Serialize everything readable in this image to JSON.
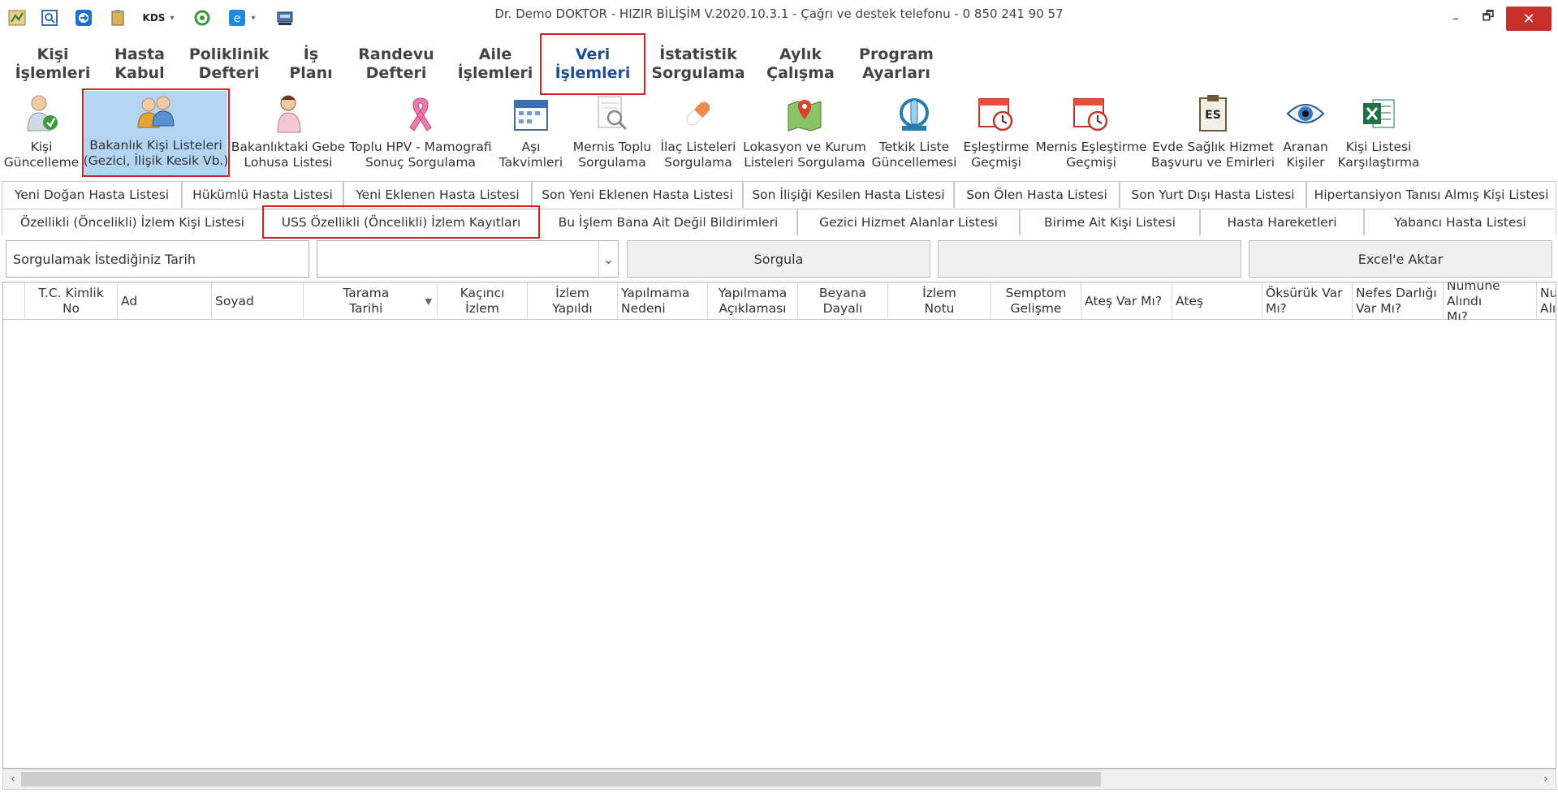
{
  "window": {
    "title": "Dr. Demo DOKTOR - HIZIR BİLİŞİM V.2020.10.3.1 - Çağrı ve destek telefonu - 0 850 241 90 57",
    "minimize": "–",
    "restore": "🗗",
    "close": "✕"
  },
  "quick_access": {
    "kds_label": "KDS",
    "dropdown_glyph": "▾"
  },
  "menu": [
    {
      "line1": "Kişi",
      "line2": "İşlemleri"
    },
    {
      "line1": "Hasta",
      "line2": "Kabul"
    },
    {
      "line1": "Poliklinik",
      "line2": "Defteri"
    },
    {
      "line1": "İş",
      "line2": "Planı"
    },
    {
      "line1": "Randevu",
      "line2": "Defteri"
    },
    {
      "line1": "Aile",
      "line2": "İşlemleri"
    },
    {
      "line1": "Veri",
      "line2": "İşlemleri"
    },
    {
      "line1": "İstatistik",
      "line2": "Sorgulama"
    },
    {
      "line1": "Aylık",
      "line2": "Çalışma"
    },
    {
      "line1": "Program",
      "line2": "Ayarları"
    }
  ],
  "ribbon": [
    {
      "line1": "Kişi",
      "line2": "Güncelleme",
      "icon": "person-update-icon"
    },
    {
      "line1": "Bakanlık Kişi Listeleri",
      "line2": "(Gezici, İlişik Kesik Vb.)",
      "icon": "people-group-icon"
    },
    {
      "line1": "Bakanlıktaki Gebe",
      "line2": "Lohusa Listesi",
      "icon": "pregnant-woman-icon"
    },
    {
      "line1": "Toplu HPV - Mamografi",
      "line2": "Sonuç Sorgulama",
      "icon": "pink-ribbon-icon"
    },
    {
      "line1": "Aşı",
      "line2": "Takvimleri",
      "icon": "calendar-icon"
    },
    {
      "line1": "Mernis Toplu",
      "line2": "Sorgulama",
      "icon": "document-search-icon"
    },
    {
      "line1": "İlaç Listeleri",
      "line2": "Sorgulama",
      "icon": "pill-icon"
    },
    {
      "line1": "Lokasyon ve Kurum",
      "line2": "Listeleri Sorgulama",
      "icon": "map-pin-icon"
    },
    {
      "line1": "Tetkik Liste",
      "line2": "Güncellemesi",
      "icon": "test-tube-refresh-icon"
    },
    {
      "line1": "Eşleştirme",
      "line2": "Geçmişi",
      "icon": "calendar-clock-icon"
    },
    {
      "line1": "Mernis Eşleştirme",
      "line2": "Geçmişi",
      "icon": "calendar-clock-icon"
    },
    {
      "line1": "Evde Sağlık Hizmet",
      "line2": "Başvuru ve Emirleri",
      "icon": "clipboard-es-icon"
    },
    {
      "line1": "Aranan",
      "line2": "Kişiler",
      "icon": "eye-icon"
    },
    {
      "line1": "Kişi Listesi",
      "line2": "Karşılaştırma",
      "icon": "excel-icon"
    }
  ],
  "ribbon_extra": {
    "es_text": "ES"
  },
  "tabs_row1": [
    "Yeni Doğan Hasta Listesi",
    "Hükümlü Hasta Listesi",
    "Yeni Eklenen Hasta Listesi",
    "Son Yeni Eklenen Hasta Listesi",
    "Son İlişiği Kesilen Hasta Listesi",
    "Son Ölen Hasta Listesi",
    "Son Yurt Dışı Hasta Listesi",
    "Hipertansiyon Tanısı Almış Kişi Listesi"
  ],
  "tabs_row2": [
    "Özellikli (Öncelikli) İzlem Kişi Listesi",
    "USS Özellikli (Öncelikli) İzlem Kayıtları",
    "Bu İşlem Bana Ait Değil Bildirimleri",
    "Gezici Hizmet Alanlar Listesi",
    "Birime Ait Kişi Listesi",
    "Hasta Hareketleri",
    "Yabancı Hasta Listesi"
  ],
  "query": {
    "date_label": "Sorgulamak İstediğiniz Tarih",
    "date_value": "",
    "dropdown_glyph": "⌄",
    "query_button": "Sorgula",
    "status_value": "",
    "export_button": "Excel'e Aktar"
  },
  "grid": {
    "columns": [
      {
        "line1": "T.C. Kimlik No",
        "line2": ""
      },
      {
        "line1": "Ad",
        "line2": ""
      },
      {
        "line1": "Soyad",
        "line2": ""
      },
      {
        "line1": "Tarama",
        "line2": "Tarihi"
      },
      {
        "line1": "Kaçıncı",
        "line2": "İzlem"
      },
      {
        "line1": "İzlem",
        "line2": "Yapıldı"
      },
      {
        "line1": "Yapılmama",
        "line2": "Nedeni"
      },
      {
        "line1": "Yapılmama",
        "line2": "Açıklaması"
      },
      {
        "line1": "Beyana",
        "line2": "Dayalı"
      },
      {
        "line1": "İzlem",
        "line2": "Notu"
      },
      {
        "line1": "Semptom",
        "line2": "Gelişme"
      },
      {
        "line1": "Ateş Var Mı?",
        "line2": ""
      },
      {
        "line1": "Ateş",
        "line2": ""
      },
      {
        "line1": "Öksürük Var",
        "line2": "Mı?"
      },
      {
        "line1": "Nefes Darlığı",
        "line2": "Var Mı?"
      },
      {
        "line1": "Numune Alındı",
        "line2": "Mı?"
      },
      {
        "line1": "Nu",
        "line2": "Alın"
      }
    ],
    "sort_glyph": "▼",
    "rows": []
  },
  "scrollbar": {
    "left": "‹",
    "right": "›"
  },
  "colors": {
    "accent": "#1f4e93",
    "highlight": "#d32027",
    "selected_bg": "#b3d4f2",
    "close_bg": "#c7302b"
  }
}
